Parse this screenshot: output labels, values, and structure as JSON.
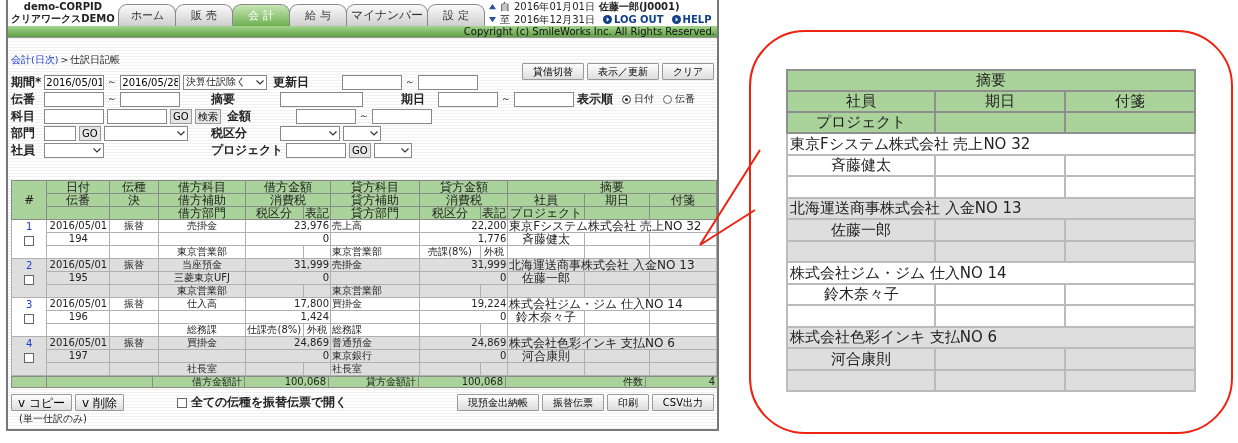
{
  "header": {
    "corp_id": "demo-CORPID",
    "company": "クリアワークスDEMO",
    "tabs": [
      {
        "label": "ホーム",
        "selected": false
      },
      {
        "label": "販 売",
        "selected": false
      },
      {
        "label": "会 計",
        "selected": true
      },
      {
        "label": "給 与",
        "selected": false
      },
      {
        "label": "マイナンバー",
        "selected": false
      },
      {
        "label": "設 定",
        "selected": false
      }
    ],
    "period": [
      {
        "label": "自",
        "date": "2016年01月01日"
      },
      {
        "label": "至",
        "date": "2016年12月31日"
      }
    ],
    "user": "佐藤一郎(J0001)",
    "links": [
      "LOG OUT",
      "HELP"
    ],
    "copyright": "Copyright (c) SmileWorks Inc. All Rights Reserved."
  },
  "breadcrumb": {
    "link": "会計(日次)",
    "separator": ">",
    "current": "仕訳日記帳"
  },
  "top_buttons": [
    "貸借切替",
    "表示／更新",
    "クリア"
  ],
  "filter_rows": [
    [
      [
        {
          "kind": "label",
          "text": "期間*"
        },
        {
          "kind": "field",
          "value": "2016/05/01"
        },
        {
          "kind": "tilde",
          "text": "～"
        },
        {
          "kind": "field",
          "value": "2016/05/28"
        },
        {
          "kind": "select_wide",
          "value": "決算仕訳除く"
        }
      ],
      [
        {
          "kind": "label",
          "text": "更新日"
        },
        {
          "kind": "field"
        },
        {
          "kind": "tilde",
          "text": "～"
        },
        {
          "kind": "field"
        }
      ],
      []
    ],
    [
      [
        {
          "kind": "label",
          "text": "伝番"
        },
        {
          "kind": "field"
        },
        {
          "kind": "tilde",
          "text": "～"
        },
        {
          "kind": "field"
        }
      ],
      [
        {
          "kind": "label",
          "text": "摘要"
        },
        {
          "kind": "field_wide"
        }
      ],
      [
        {
          "kind": "label",
          "text": "期日"
        },
        {
          "kind": "field"
        },
        {
          "kind": "tilde",
          "text": "～"
        },
        {
          "kind": "field"
        },
        {
          "kind": "label",
          "text": "表示順"
        },
        {
          "kind": "radio",
          "text": "日付",
          "selected": true
        },
        {
          "kind": "radio",
          "text": "伝番",
          "selected": false
        }
      ]
    ],
    [
      [
        {
          "kind": "label",
          "text": "科目"
        },
        {
          "kind": "field"
        },
        {
          "kind": "field"
        },
        {
          "kind": "go",
          "text": "GO"
        },
        {
          "kind": "button",
          "text": "検索"
        }
      ],
      [
        {
          "kind": "label",
          "text": "金額"
        },
        {
          "kind": "field"
        },
        {
          "kind": "tilde",
          "text": "～"
        },
        {
          "kind": "field"
        }
      ],
      []
    ],
    [
      [
        {
          "kind": "label",
          "text": "部門"
        },
        {
          "kind": "field_narrow"
        },
        {
          "kind": "go",
          "text": "GO"
        },
        {
          "kind": "select_wide"
        }
      ],
      [
        {
          "kind": "label",
          "text": "税区分"
        },
        {
          "kind": "select"
        },
        {
          "kind": "select_narrow"
        }
      ],
      []
    ],
    [
      [
        {
          "kind": "label",
          "text": "社員"
        },
        {
          "kind": "select"
        }
      ],
      [
        {
          "kind": "label",
          "text": "プロジェクト"
        },
        {
          "kind": "field"
        },
        {
          "kind": "go",
          "text": "GO"
        },
        {
          "kind": "select_narrow"
        }
      ],
      []
    ]
  ],
  "table": {
    "header_rows": [
      [
        "#",
        "日付",
        "伝種",
        "借方科目",
        "借方金額",
        "貸方科目",
        "貸方金額",
        "摘要"
      ],
      [
        "伝番",
        "決",
        "借方補助",
        "消費税",
        "貸方補助",
        "消費税",
        "社員",
        "期日",
        "付箋"
      ],
      [
        "借方部門",
        "税区分",
        "表記",
        "貸方部門",
        "税区分",
        "表記",
        "プロジェクト"
      ]
    ],
    "records": [
      {
        "no": "1",
        "checked": false,
        "date": "2016/05/01",
        "type": "振替",
        "voucher": "194",
        "debit": {
          "account": "売掛金",
          "amount": "23,976",
          "tax": "0",
          "dept": "東京営業部"
        },
        "credit": {
          "account": "売上高",
          "amount": "22,200",
          "tax": "1,776",
          "dept": "東京営業部",
          "tax_class": "売課(8%)",
          "tax_mark": "外税"
        },
        "memo": "東京Fシステム株式会社 売上NO 32",
        "employee": "斉藤健太"
      },
      {
        "no": "2",
        "checked": false,
        "date": "2016/05/01",
        "type": "振替",
        "voucher": "195",
        "debit": {
          "account": "当座預金",
          "sub": "三菱東京UFJ",
          "amount": "31,999",
          "tax": "0",
          "dept": "東京営業部"
        },
        "credit": {
          "account": "売掛金",
          "amount": "31,999",
          "tax": "0",
          "dept": "東京営業部"
        },
        "memo": "北海運送商事株式会社 入金NO 13",
        "employee": "佐藤一郎"
      },
      {
        "no": "3",
        "checked": false,
        "date": "2016/05/01",
        "type": "振替",
        "voucher": "196",
        "debit": {
          "account": "仕入高",
          "amount": "17,800",
          "tax": "1,424",
          "dept": "総務課",
          "tax_class": "仕課売(8%)",
          "tax_mark": "外税"
        },
        "credit": {
          "account": "買掛金",
          "amount": "19,224",
          "tax": "0",
          "dept": "総務課"
        },
        "memo": "株式会社ジム・ジム 仕入NO 14",
        "employee": "鈴木奈々子"
      },
      {
        "no": "4",
        "checked": false,
        "date": "2016/05/01",
        "type": "振替",
        "voucher": "197",
        "debit": {
          "account": "買掛金",
          "amount": "24,869",
          "tax": "0",
          "dept": "社長室"
        },
        "credit": {
          "account": "普通預金",
          "sub": "東京銀行",
          "amount": "24,869",
          "tax": "0",
          "dept": "社長室"
        },
        "memo": "株式会社色彩インキ 支払NO 6",
        "employee": "河合康則"
      }
    ],
    "totals": {
      "debit_label": "借方金額計",
      "debit": "100,068",
      "credit_label": "貸方金額計",
      "credit": "100,068",
      "count_label": "件数",
      "count": "4"
    }
  },
  "bottom": {
    "left_buttons": [
      "v コピー",
      "v 削除"
    ],
    "note": "(単一仕訳のみ)",
    "open_all": {
      "label": "全ての伝種を振替伝票で開く",
      "checked": false
    },
    "right_buttons": [
      "現預金出納帳",
      "振替伝票",
      "印刷",
      "CSV出力"
    ]
  },
  "callout": {
    "header_rows": [
      [
        "摘要"
      ],
      [
        "社員",
        "期日",
        "付箋"
      ],
      [
        "プロジェクト"
      ]
    ],
    "rows": [
      {
        "memo": "東京Fシステム株式会社 売上NO 32",
        "employee": "斉藤健太"
      },
      {
        "memo": "北海運送商事株式会社 入金NO 13",
        "employee": "佐藤一郎"
      },
      {
        "memo": "株式会社ジム・ジム 仕入NO 14",
        "employee": "鈴木奈々子"
      },
      {
        "memo": "株式会社色彩インキ 支払NO 6",
        "employee": "河合康則"
      }
    ]
  }
}
